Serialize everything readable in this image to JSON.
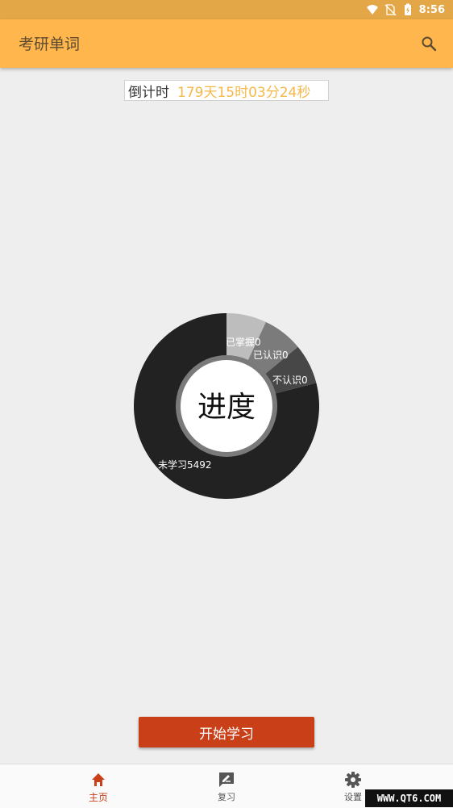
{
  "status_bar": {
    "time": "8:56",
    "icons": [
      "wifi-icon",
      "no-sim-icon",
      "battery-icon"
    ]
  },
  "app_bar": {
    "title": "考研单词",
    "search_icon": "search-icon"
  },
  "countdown": {
    "label": "倒计时",
    "value": "179天15时03分24秒"
  },
  "chart_data": {
    "type": "pie",
    "center_label": "进度",
    "slices": [
      {
        "name": "已掌握",
        "value": 0,
        "label": "已掌握0",
        "color": "#bdbdbd",
        "display_fraction": 0.07
      },
      {
        "name": "已认识",
        "value": 0,
        "label": "已认识0",
        "color": "#7b7b7b",
        "display_fraction": 0.07
      },
      {
        "name": "不认识",
        "value": 0,
        "label": "不认识0",
        "color": "#474747",
        "display_fraction": 0.07
      },
      {
        "name": "未学习",
        "value": 5492,
        "label": "未学习5492",
        "color": "#222222",
        "display_fraction": 0.79
      }
    ]
  },
  "start_button": {
    "label": "开始学习"
  },
  "bottom_nav": {
    "items": [
      {
        "label": "主页",
        "icon": "home-icon",
        "active": true
      },
      {
        "label": "复习",
        "icon": "review-icon",
        "active": false
      },
      {
        "label": "设置",
        "icon": "gear-icon",
        "active": false
      }
    ]
  },
  "watermark": {
    "text": "WWW.QT6.COM"
  },
  "colors": {
    "accent": "#ffb74d",
    "primary_button": "#c94018",
    "countdown_text": "#f5b94a"
  }
}
